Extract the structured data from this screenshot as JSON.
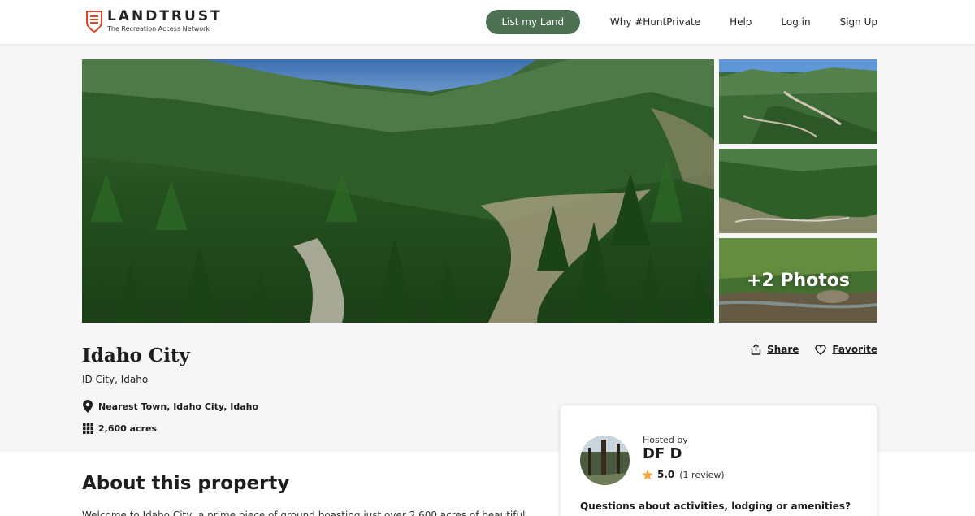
{
  "header": {
    "logo_title": "LANDTRUST",
    "logo_subtitle": "The Recreation Access Network",
    "list_button": "List my Land",
    "nav": [
      "Why #HuntPrivate",
      "Help",
      "Log in",
      "Sign Up"
    ]
  },
  "gallery": {
    "more_photos": "+2 Photos"
  },
  "property": {
    "title": "Idaho City",
    "location": "ID City, Idaho",
    "nearest_town": "Nearest Town, Idaho City, Idaho",
    "acres": "2,600 acres"
  },
  "actions": {
    "share": "Share",
    "favorite": "Favorite"
  },
  "about": {
    "title": "About this property",
    "text": "Welcome to Idaho City, a prime piece of ground boasting just over 2,600 acres of beautiful"
  },
  "host": {
    "hosted_by": "Hosted by",
    "name": "DF D",
    "rating": "5.0",
    "reviews": "(1 review)",
    "questions": "Questions about activities, lodging or amenities?"
  },
  "colors": {
    "brand_green": "#4d6f52",
    "logo_red": "#d9482b",
    "star": "#f3a93b"
  },
  "icons": [
    "shield-logo-icon",
    "location-pin-icon",
    "grid-icon",
    "share-icon",
    "heart-icon",
    "star-icon"
  ]
}
